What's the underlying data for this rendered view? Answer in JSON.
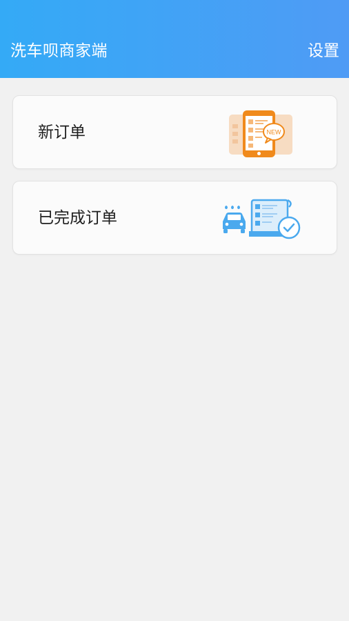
{
  "header": {
    "title": "洗车呗商家端",
    "settings_label": "设置"
  },
  "cards": [
    {
      "label": "新订单",
      "icon": "new-order-icon",
      "badge": "NEW"
    },
    {
      "label": "已完成订单",
      "icon": "completed-order-icon"
    }
  ],
  "colors": {
    "header_start": "#34aaf6",
    "header_end": "#4f9bf5",
    "background": "#f1f1f1",
    "orange_accent": "#f08a1c",
    "blue_accent": "#4aa9ee"
  }
}
